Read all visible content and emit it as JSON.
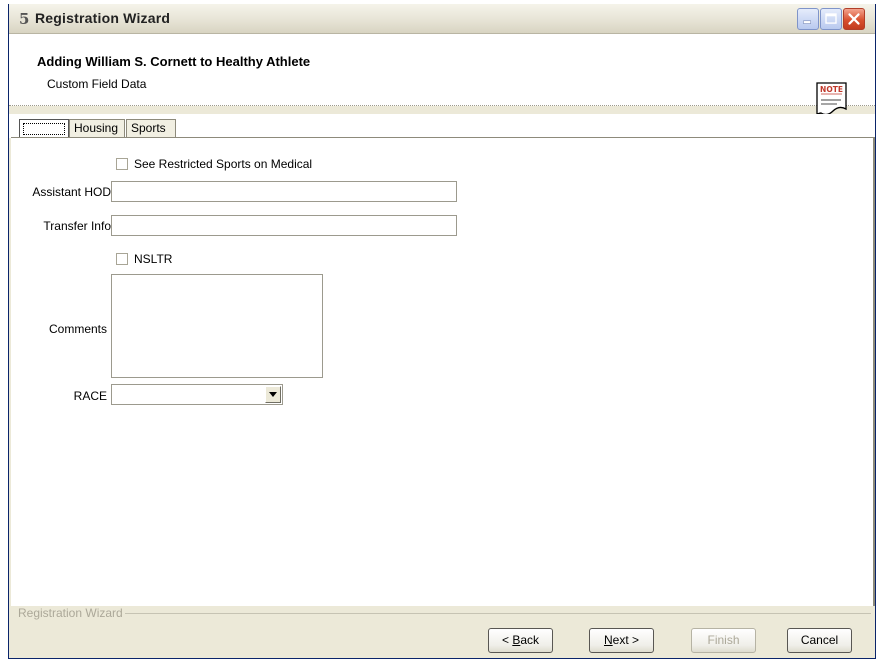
{
  "window": {
    "app_icon_glyph": "5",
    "title": "Registration Wizard",
    "controls": [
      "minimize",
      "maximize",
      "close"
    ]
  },
  "header": {
    "title": "Adding William S. Cornett to Healthy Athlete",
    "subtitle": "Custom Field Data",
    "note_icon_text": "NOTE"
  },
  "tabs": [
    {
      "label": ""
    },
    {
      "label": "Housing"
    },
    {
      "label": "Sports"
    }
  ],
  "form": {
    "restricted_sports_checkbox": {
      "label": "See Restricted Sports on Medical",
      "checked": false
    },
    "assistant_hod": {
      "label": "Assistant HOD",
      "value": ""
    },
    "transfer_info": {
      "label": "Transfer Info",
      "value": ""
    },
    "nsltr_checkbox": {
      "label": "NSLTR",
      "checked": false
    },
    "comments": {
      "label": "Comments",
      "value": ""
    },
    "race": {
      "label": "RACE",
      "value": ""
    }
  },
  "footer": {
    "group_label": "Registration Wizard",
    "back": {
      "pre": "< ",
      "mnemonic": "B",
      "rest": "ack"
    },
    "next": {
      "mnemonic": "N",
      "rest": "ext >"
    },
    "finish": "Finish",
    "cancel": "Cancel"
  },
  "colors": {
    "window_bg": "#ece9d8",
    "close_button": "#d8502f",
    "disabled_text": "#aca899"
  }
}
